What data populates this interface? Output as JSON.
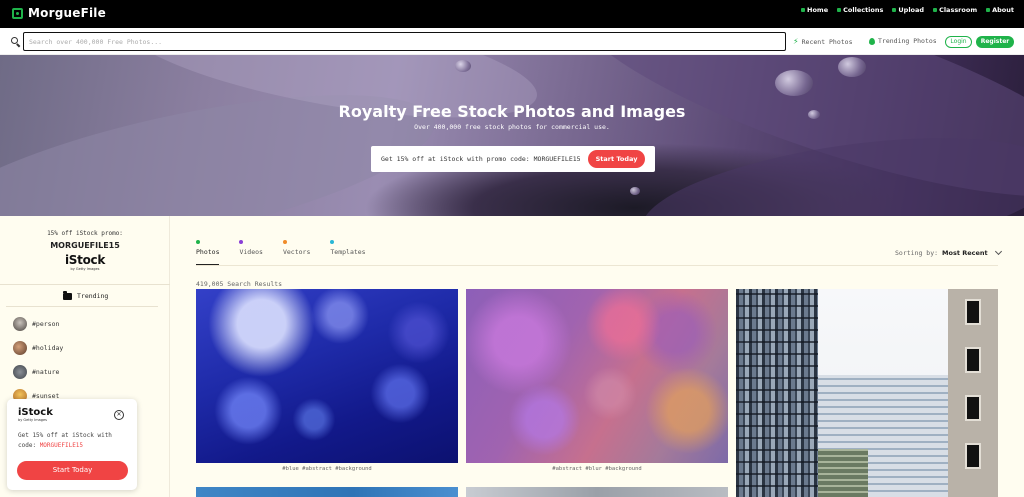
{
  "app": {
    "logo_text": "MorgueFile"
  },
  "nav": {
    "links": [
      "Home",
      "Collections",
      "Upload",
      "Classroom",
      "About"
    ]
  },
  "search": {
    "placeholder": "Search over 400,000 Free Photos...",
    "value": ""
  },
  "quick_links": {
    "recent": "Recent Photos",
    "trending": "Trending Photos",
    "login": "Login",
    "register": "Register"
  },
  "hero": {
    "title": "Royalty Free Stock Photos and Images",
    "subtitle": "Over 400,000 free stock photos for commercial use.",
    "promo_text": "Get 15% off at iStock with promo code: MORGUEFILE15",
    "promo_button": "Start Today"
  },
  "sidebar": {
    "promo_label": "15% off iStock promo:",
    "promo_code": "MORGUEFILE15",
    "istock_brand": "iStock",
    "istock_by": "by Getty Images",
    "trending_label": "Trending",
    "tags": [
      "#person",
      "#holiday",
      "#nature",
      "#sunset"
    ]
  },
  "popup": {
    "brand": "iStock",
    "by": "by Getty Images",
    "text_prefix": "Get 15% off at iStock with code:",
    "code": "MORGUEFILE15",
    "button": "Start Today"
  },
  "tabs": [
    {
      "label": "Photos",
      "color": "#1fb34a"
    },
    {
      "label": "Videos",
      "color": "#8a3fd6"
    },
    {
      "label": "Vectors",
      "color": "#f08c2a"
    },
    {
      "label": "Templates",
      "color": "#2ab7d6"
    }
  ],
  "sorting": {
    "label": "Sorting by:",
    "value": "Most Recent"
  },
  "results": {
    "count": "419,005 Search Results"
  },
  "photos": [
    {
      "tags": "#blue #abstract #background"
    },
    {
      "tags": "#abstract #blur #background"
    }
  ],
  "colors": {
    "brand_green": "#1fb34a",
    "promo_red": "#f04444",
    "page_bg": "#fffdf0"
  }
}
